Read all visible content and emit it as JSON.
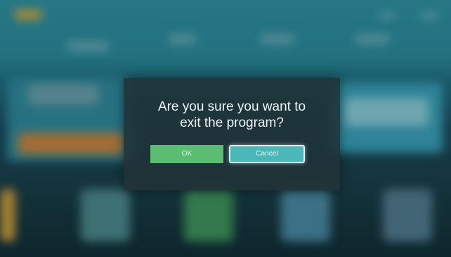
{
  "dialog": {
    "message": "Are you sure you want to\nexit the program?",
    "ok_label": "OK",
    "cancel_label": "Cancel",
    "focused_button": "Cancel"
  },
  "colors": {
    "ok_button": "#5bbd72",
    "cancel_button": "#4bb7b9",
    "dialog_background": "#203238"
  }
}
